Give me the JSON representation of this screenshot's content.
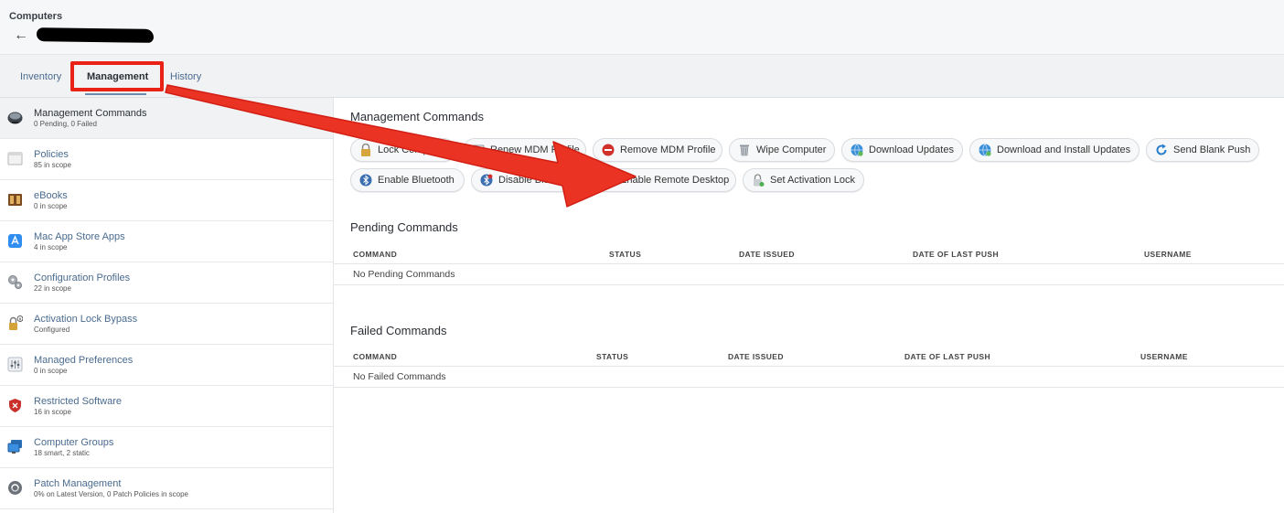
{
  "header": {
    "breadcrumb": "Computers"
  },
  "tabs": [
    {
      "label": "Inventory",
      "active": false
    },
    {
      "label": "Management",
      "active": true
    },
    {
      "label": "History",
      "active": false
    }
  ],
  "sidebar": {
    "items": [
      {
        "title": "Management Commands",
        "subtitle": "0 Pending, 0 Failed",
        "icon": "terminal-icon",
        "active": true
      },
      {
        "title": "Policies",
        "subtitle": "85 in scope",
        "icon": "document-icon",
        "active": false
      },
      {
        "title": "eBooks",
        "subtitle": "0 in scope",
        "icon": "book-icon",
        "active": false
      },
      {
        "title": "Mac App Store Apps",
        "subtitle": "4 in scope",
        "icon": "app-store-icon",
        "active": false
      },
      {
        "title": "Configuration Profiles",
        "subtitle": "22 in scope",
        "icon": "gears-icon",
        "active": false
      },
      {
        "title": "Activation Lock Bypass",
        "subtitle": "Configured",
        "icon": "lock-info-icon",
        "active": false
      },
      {
        "title": "Managed Preferences",
        "subtitle": "0 in scope",
        "icon": "sliders-icon",
        "active": false
      },
      {
        "title": "Restricted Software",
        "subtitle": "16 in scope",
        "icon": "shield-icon",
        "active": false
      },
      {
        "title": "Computer Groups",
        "subtitle": "18 smart, 2 static",
        "icon": "computers-icon",
        "active": false
      },
      {
        "title": "Patch Management",
        "subtitle": "0% on Latest Version, 0 Patch Policies in scope",
        "icon": "patch-icon",
        "active": false
      }
    ]
  },
  "main": {
    "management_title": "Management Commands",
    "buttons": [
      {
        "label": "Lock Computer",
        "icon": "lock-icon"
      },
      {
        "label": "Renew MDM Profile",
        "icon": "refresh-profile-icon"
      },
      {
        "label": "Remove MDM Profile",
        "icon": "remove-icon"
      },
      {
        "label": "Wipe Computer",
        "icon": "trash-icon"
      },
      {
        "label": "Download Updates",
        "icon": "globe-download-icon"
      },
      {
        "label": "Download and Install Updates",
        "icon": "globe-install-icon"
      },
      {
        "label": "Send Blank Push",
        "icon": "push-refresh-icon"
      },
      {
        "label": "Enable Bluetooth",
        "icon": "bluetooth-icon"
      },
      {
        "label": "Disable Bluetooth",
        "icon": "bluetooth-off-icon"
      },
      {
        "label": "Enable Remote Desktop",
        "icon": "remote-desktop-icon"
      },
      {
        "label": "Set Activation Lock",
        "icon": "activation-lock-icon"
      }
    ],
    "pending": {
      "title": "Pending Commands",
      "columns": [
        "COMMAND",
        "STATUS",
        "DATE ISSUED",
        "DATE OF LAST PUSH",
        "USERNAME"
      ],
      "empty_text": "No Pending Commands"
    },
    "failed": {
      "title": "Failed Commands",
      "columns": [
        "COMMAND",
        "STATUS",
        "DATE ISSUED",
        "DATE OF LAST PUSH",
        "USERNAME"
      ],
      "empty_text": "No Failed Commands"
    }
  },
  "colors": {
    "highlight": "#e92215",
    "link": "#4a6b8f"
  }
}
